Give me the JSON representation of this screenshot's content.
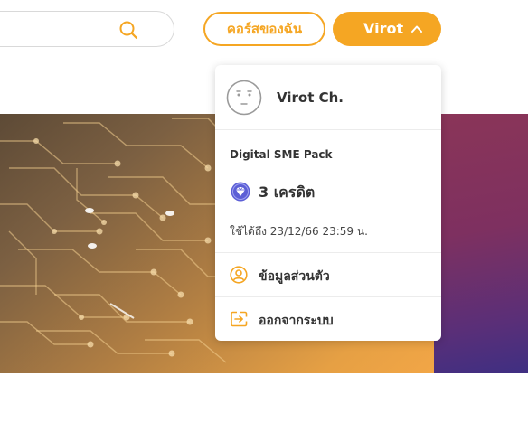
{
  "search": {
    "placeholder": ""
  },
  "header": {
    "my_courses_label": "คอร์สของฉัน",
    "user_button_label": "Virot"
  },
  "menu": {
    "user_name": "Virot Ch.",
    "pack_name": "Digital SME Pack",
    "credits": "3 เครดิต",
    "valid_until": "ใช้ได้ถึง 23/12/66 23:59 น.",
    "profile_label": "ข้อมูลส่วนตัว",
    "logout_label": "ออกจากระบบ"
  },
  "colors": {
    "accent": "#f5a623",
    "diamond": "#5c5fd6",
    "banner_right": "#7e3060"
  },
  "icons": [
    "search-icon",
    "chevron-up-icon",
    "avatar-face-icon",
    "diamond-icon",
    "user-circle-icon",
    "logout-icon"
  ]
}
